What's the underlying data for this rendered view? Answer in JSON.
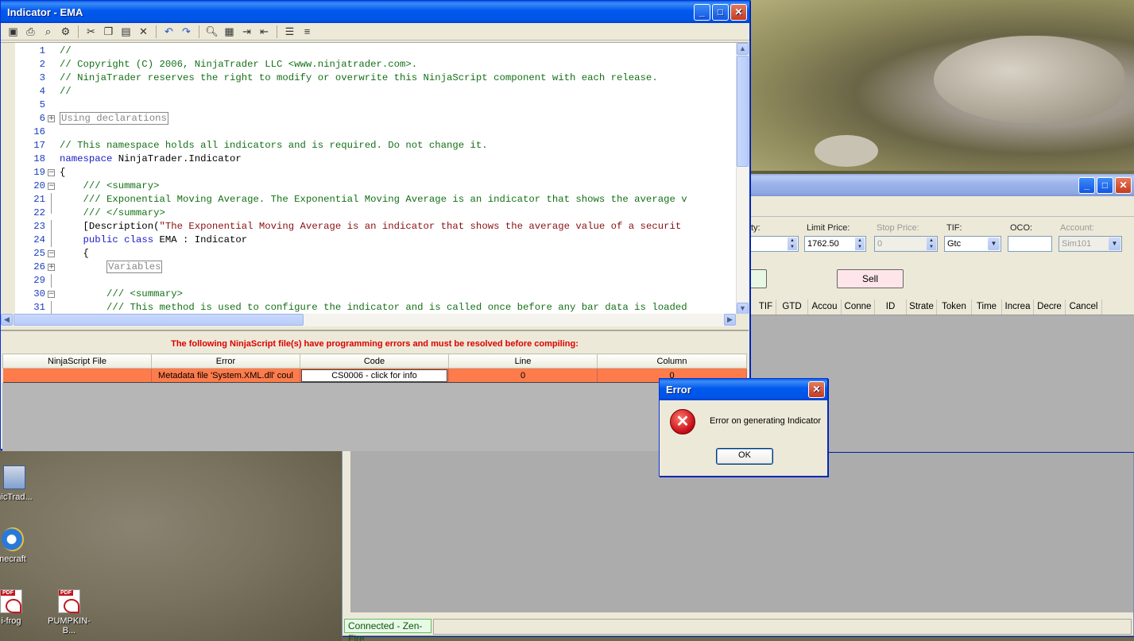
{
  "editor": {
    "title": "Indicator - EMA",
    "code_lines": [
      {
        "num": "1",
        "text": "//",
        "cls": "cm",
        "fold": ""
      },
      {
        "num": "2",
        "text": "// Copyright (C) 2006, NinjaTrader LLC <www.ninjatrader.com>.",
        "cls": "cm",
        "fold": ""
      },
      {
        "num": "3",
        "text": "// NinjaTrader reserves the right to modify or overwrite this NinjaScript component with each release.",
        "cls": "cm",
        "fold": ""
      },
      {
        "num": "4",
        "text": "//",
        "cls": "cm",
        "fold": ""
      },
      {
        "num": "5",
        "text": "",
        "cls": "",
        "fold": ""
      },
      {
        "num": "6",
        "text": "Using declarations",
        "cls": "region",
        "fold": "plus"
      },
      {
        "num": "16",
        "text": "",
        "cls": "",
        "fold": ""
      },
      {
        "num": "17",
        "text": "// This namespace holds all indicators and is required. Do not change it.",
        "cls": "cm",
        "fold": ""
      },
      {
        "num": "18",
        "text": "namespace NinjaTrader.Indicator",
        "cls": "ns",
        "fold": ""
      },
      {
        "num": "19",
        "text": "{",
        "cls": "",
        "fold": "minus"
      },
      {
        "num": "20",
        "text": "    /// <summary>",
        "cls": "cm",
        "fold": "minus"
      },
      {
        "num": "21",
        "text": "    /// Exponential Moving Average. The Exponential Moving Average is an indicator that shows the average v",
        "cls": "cm",
        "fold": "line"
      },
      {
        "num": "22",
        "text": "    /// </summary>",
        "cls": "cm",
        "fold": "end"
      },
      {
        "num": "23",
        "text": "    [Description(\"The Exponential Moving Average is an indicator that shows the average value of a securit",
        "cls": "desc",
        "fold": "line"
      },
      {
        "num": "24",
        "text": "    public class EMA : Indicator",
        "cls": "cls",
        "fold": "line"
      },
      {
        "num": "25",
        "text": "    {",
        "cls": "",
        "fold": "minus"
      },
      {
        "num": "26",
        "text": "        Variables",
        "cls": "region",
        "fold": "plus"
      },
      {
        "num": "29",
        "text": "",
        "cls": "",
        "fold": "line"
      },
      {
        "num": "30",
        "text": "        /// <summary>",
        "cls": "cm",
        "fold": "minus"
      },
      {
        "num": "31",
        "text": "        /// This method is used to configure the indicator and is called once before any bar data is loaded",
        "cls": "cm",
        "fold": "line"
      }
    ],
    "errors": {
      "heading": "The following NinjaScript file(s) have programming errors and must be resolved before compiling:",
      "columns": [
        "NinjaScript File",
        "Error",
        "Code",
        "Line",
        "Column"
      ],
      "row": {
        "file": "",
        "error": "Metadata file 'System.XML.dll' coul",
        "code": "CS0006 - click for info",
        "line": "0",
        "column": "0"
      }
    }
  },
  "order_entry": {
    "labels": {
      "qty": "ty:",
      "limit_price": "Limit Price:",
      "stop_price": "Stop Price:",
      "tif": "TIF:",
      "oco": "OCO:",
      "account": "Account:"
    },
    "values": {
      "limit_price": "1762.50",
      "stop_price": "0",
      "tif": "Gtc",
      "account": "Sim101"
    },
    "sell_label": "Sell",
    "columns": [
      "TIF",
      "GTD",
      "Accou",
      "Conne",
      "ID",
      "Strate",
      "Token",
      "Time",
      "Increa",
      "Decre",
      "Cancel"
    ]
  },
  "status": {
    "connection": "Connected - Zen-Fire"
  },
  "dialog": {
    "title": "Error",
    "message": "Error on generating Indicator",
    "ok_label": "OK"
  },
  "desktop": {
    "icons": [
      {
        "label": "nicTrad..."
      },
      {
        "label": "necraft"
      },
      {
        "label": "i-frog"
      },
      {
        "label": "PUMPKIN-B..."
      }
    ]
  },
  "colors": {
    "error_row": "#fe7b4b",
    "error_heading": "#dd0000",
    "xp_title_blue": "#0058ee",
    "connected_green": "#e6fbe6"
  }
}
